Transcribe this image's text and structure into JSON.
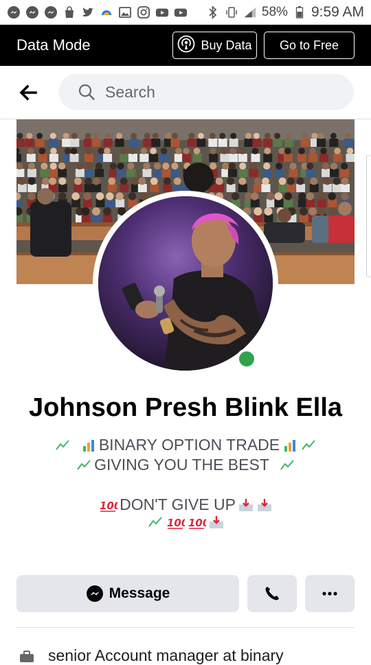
{
  "status_bar": {
    "battery": "58%",
    "time": "9:59 AM"
  },
  "data_mode": {
    "title": "Data Mode",
    "buy_data_label": "Buy Data",
    "go_free_label": "Go to Free"
  },
  "search": {
    "placeholder": "Search"
  },
  "profile": {
    "name": "Johnson Presh Blink Ella",
    "bio_line1": "BINARY OPTION TRADE",
    "bio_line2": "GIVING YOU THE BEST",
    "bio_line3": "DON'T GIVE UP",
    "online": true
  },
  "actions": {
    "message_label": "Message"
  },
  "about": {
    "work": "senior Account manager at binary"
  },
  "colors": {
    "online_green": "#31a24c",
    "button_grey": "#e4e6eb",
    "data_bar": "#000000"
  }
}
